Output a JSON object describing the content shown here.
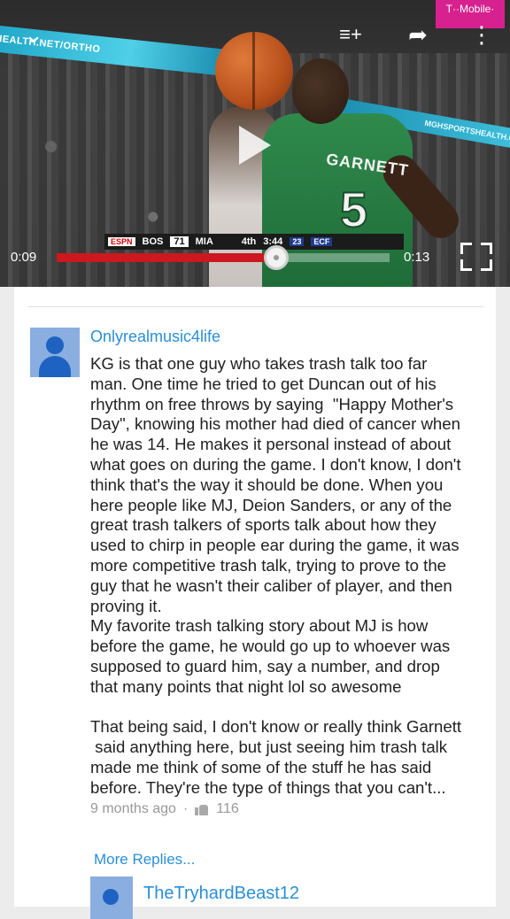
{
  "player": {
    "time_current": "0:09",
    "time_total": "0:13",
    "progress": 0.66,
    "overlay": {
      "banner_left": "HEALTH.NET/ORTHO",
      "banner_right": "MGHSPORTSHEALTH.ORG",
      "badge": "T··Mobile·",
      "jersey_name": "GARNETT",
      "jersey_number": "5"
    },
    "scoreboard": {
      "network": "ESPN",
      "team1": "BOS",
      "score1": "71",
      "team2": "MIA",
      "period": "4th",
      "clock": "3:44",
      "shot_clock": "23",
      "tag": "ECF"
    },
    "icons": {
      "collapse": "chevron-down-icon",
      "add_to_playlist": "playlist-add-icon",
      "share": "share-icon",
      "more": "more-vert-icon",
      "play": "play-icon",
      "fullscreen": "fullscreen-icon"
    },
    "glyphs": {
      "collapse": "⌄",
      "playlist": "≡+",
      "share": "➦",
      "more": "⋮"
    }
  },
  "comment": {
    "author": "Onlyrealmusic4life",
    "text": "KG is that one guy who takes trash talk too far\nman. One time he tried to get Duncan out of his\nrhythm on free throws by saying  \"Happy Mother's\nDay\", knowing his mother had died of cancer when\nhe was 14. He makes it personal instead of about\nwhat goes on during the game. I don't know, I don't\nthink that's the way it should be done. When you\nhere people like MJ, Deion Sanders, or any of the\ngreat trash talkers of sports talk about how they\nused to chirp in people ear during the game, it was\nmore competitive trash talk, trying to prove to the\nguy that he wasn't their caliber of player, and then\nproving it.\nMy favorite trash talking story about MJ is how\nbefore the game, he would go up to whoever was\nsupposed to guard him, say a number, and drop\nthat many points that night lol so awesome\n\nThat being said, I don't know or really think Garnett\n said anything here, but just seeing him trash talk\nmade me think of some of the stuff he has said\nbefore. They're the type of things that you can't...",
    "time_ago": "9 months ago",
    "separator": "·",
    "likes": "116"
  },
  "more_replies_label": "More Replies...",
  "reply": {
    "author": "TheTryhardBeast12"
  },
  "colors": {
    "link": "#2a8fd6",
    "progress": "#cc181e",
    "avatar_bg": "#8aaee0",
    "avatar_fg": "#1e63c2"
  }
}
